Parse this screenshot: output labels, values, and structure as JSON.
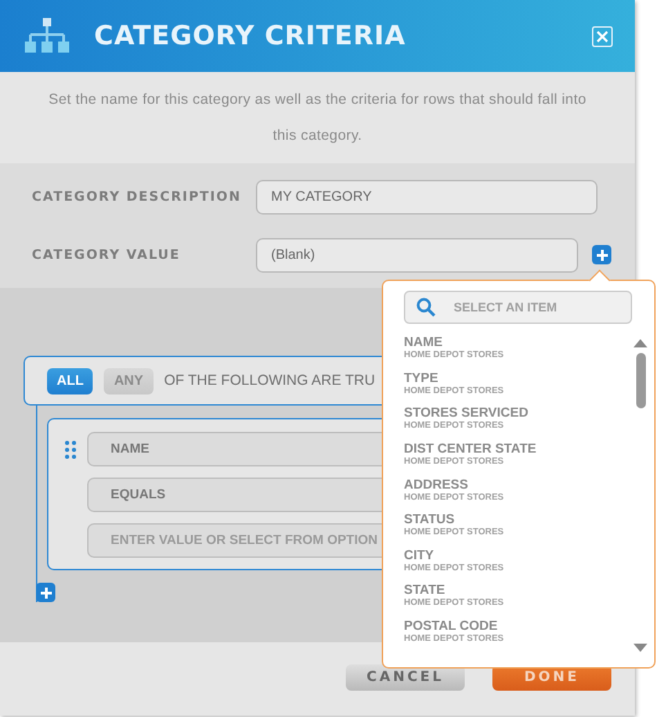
{
  "dialog": {
    "title": "CATEGORY CRITERIA",
    "description": "Set the name for this category as well as the criteria for rows that should fall into this category."
  },
  "form": {
    "description_label": "CATEGORY DESCRIPTION",
    "description_value": "MY CATEGORY",
    "value_label": "CATEGORY VALUE",
    "value_value": "(Blank)"
  },
  "criteria": {
    "modes": [
      {
        "label": "ALL",
        "selected": true
      },
      {
        "label": "ANY",
        "selected": false
      }
    ],
    "match_text": "OF THE FOLLOWING ARE TRU",
    "field": "NAME",
    "operator": "EQUALS",
    "value_placeholder": "ENTER VALUE OR SELECT FROM OPTION"
  },
  "dropdown": {
    "search_placeholder": "SELECT AN ITEM",
    "items": [
      {
        "name": "NAME",
        "source": "HOME DEPOT STORES"
      },
      {
        "name": "TYPE",
        "source": "HOME DEPOT STORES"
      },
      {
        "name": "STORES SERVICED",
        "source": "HOME DEPOT STORES"
      },
      {
        "name": "DIST CENTER STATE",
        "source": "HOME DEPOT STORES"
      },
      {
        "name": "ADDRESS",
        "source": "HOME DEPOT STORES"
      },
      {
        "name": "STATUS",
        "source": "HOME DEPOT STORES"
      },
      {
        "name": "CITY",
        "source": "HOME DEPOT STORES"
      },
      {
        "name": "STATE",
        "source": "HOME DEPOT STORES"
      },
      {
        "name": "POSTAL CODE",
        "source": "HOME DEPOT STORES"
      }
    ]
  },
  "buttons": {
    "cancel": "CANCEL",
    "done": "DONE"
  }
}
